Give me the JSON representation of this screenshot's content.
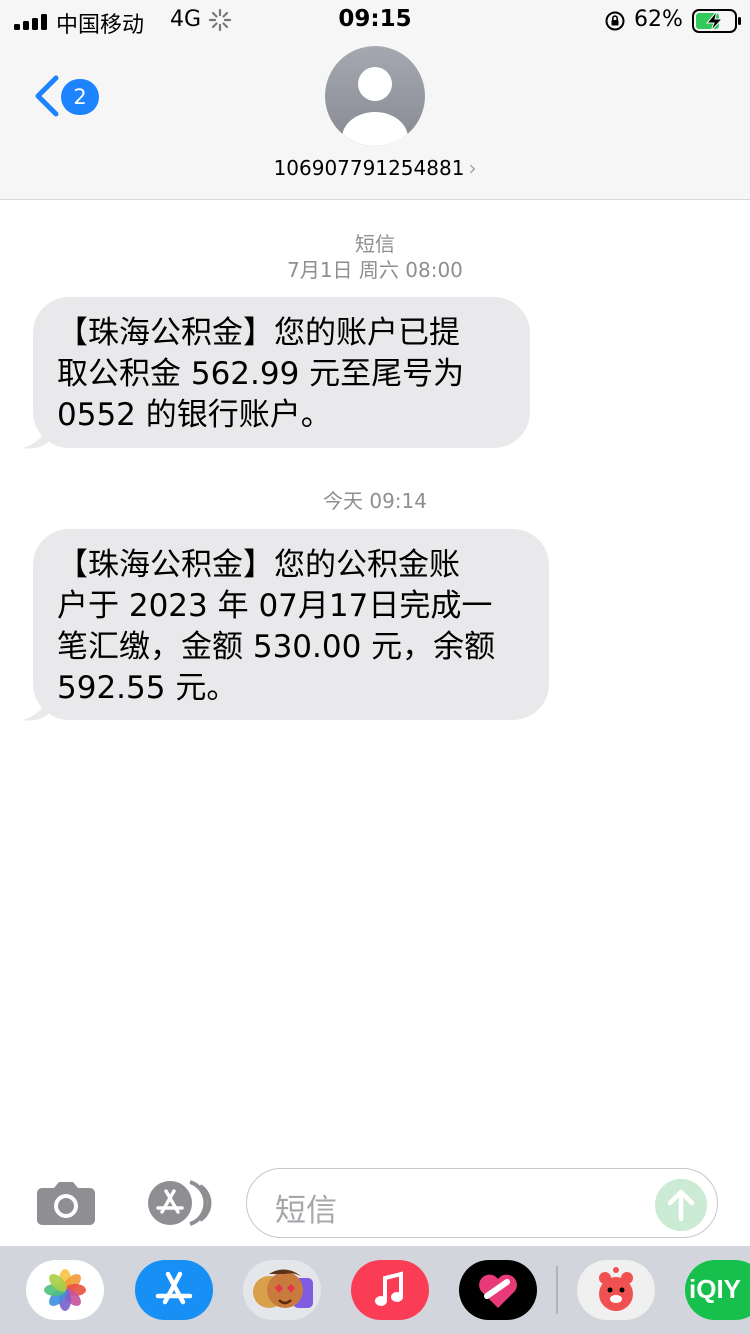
{
  "status_bar": {
    "carrier": "中国移动",
    "network": "4G",
    "time": "09:15",
    "battery_percent": "62%",
    "battery_level": 0.62
  },
  "header": {
    "unread_count": "2",
    "contact_name": "106907791254881",
    "chevron": "›"
  },
  "conversation": {
    "service_label": "短信",
    "first_timestamp": "7月1日 周六 08:00",
    "second_timestamp": "今天 09:14",
    "messages": [
      {
        "lines": [
          "【珠海公积金】您的账户已提",
          "取公积金 562.99 元至尾号为",
          "0552 的银行账户。"
        ]
      },
      {
        "lines": [
          "【珠海公积金】您的公积金账",
          "户于 2023 年 07月17日完成一",
          "笔汇缴，金额 530.00 元，余额",
          "592.55 元。"
        ]
      }
    ]
  },
  "compose": {
    "placeholder": "短信"
  },
  "dock": {
    "apps": [
      "photos-icon",
      "app-store-icon",
      "memoji-icon",
      "music-icon",
      "heart-app-icon",
      "red-bear-app-icon",
      "iqiyi-icon"
    ],
    "iqiyi_label": "iQIY"
  },
  "colors": {
    "accent": "#1d83ff",
    "bubble": "#e9e9eb",
    "send_disabled": "#ccebd4",
    "meta_text": "#8e8e93"
  }
}
